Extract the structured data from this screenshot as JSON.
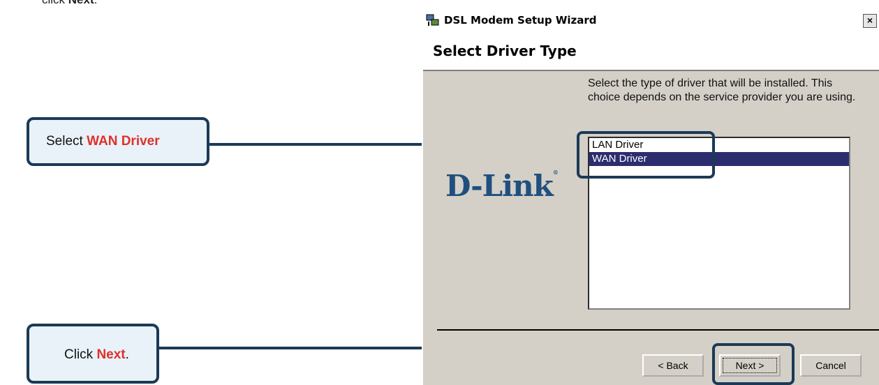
{
  "instruction": {
    "prefix": "click ",
    "bold": "Next",
    "suffix": "."
  },
  "callouts": {
    "select": {
      "prefix": "Select ",
      "highlight": "WAN Driver",
      "suffix": ""
    },
    "click": {
      "prefix": "Click ",
      "highlight": "Next",
      "suffix": "."
    }
  },
  "window": {
    "title": "DSL Modem Setup Wizard",
    "close_label": "×",
    "heading": "Select Driver Type",
    "description": "Select the type of driver that will be installed. This choice depends on the service provider you are using.",
    "logo": "D-Link",
    "logo_mark": "®",
    "drivers": [
      "LAN Driver",
      "WAN Driver"
    ],
    "selected_driver": "WAN Driver",
    "buttons": {
      "back": "< Back",
      "next": "Next >",
      "cancel": "Cancel"
    }
  },
  "colors": {
    "callout_border": "#1b3a56",
    "highlight_text": "#e0302a",
    "selection": "#2b2d6e",
    "logo": "#1f4f7e"
  }
}
